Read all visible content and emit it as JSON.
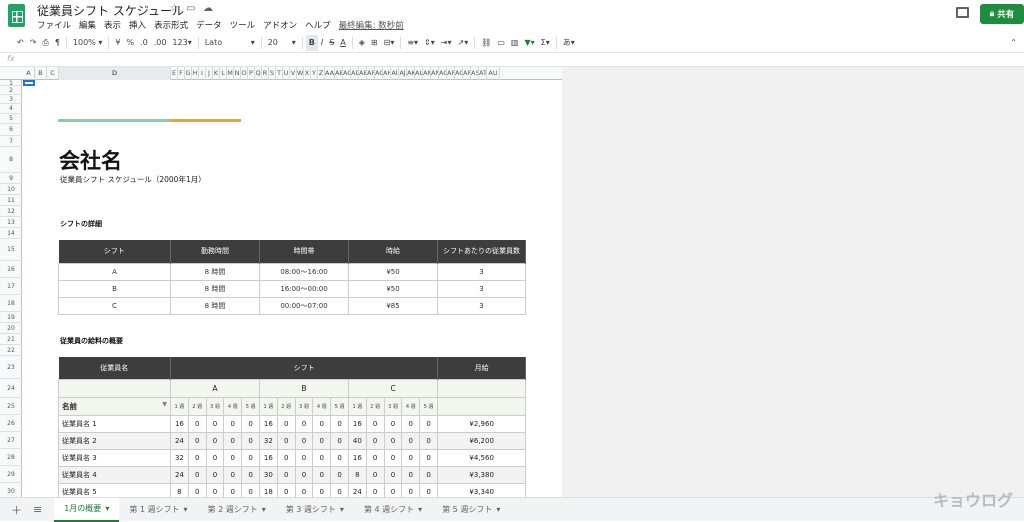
{
  "app": {
    "title": "従業員シフト スケジュール",
    "menu": [
      "ファイル",
      "編集",
      "表示",
      "挿入",
      "表示形式",
      "データ",
      "ツール",
      "アドオン",
      "ヘルプ"
    ],
    "last_edit": "最終編集: 数秒前",
    "share_label": "共有"
  },
  "toolbar": {
    "zoom": "100%",
    "currency": "¥",
    "percent": "%",
    "dec_less": ".0",
    "dec_more": ".00",
    "format": "123",
    "font": "Lato",
    "font_size": "20",
    "bold": "B",
    "italic": "I",
    "strike": "S",
    "text_color": "A",
    "lang": "あ"
  },
  "formula": {
    "fx": "fx"
  },
  "columns": [
    "A",
    "B",
    "C",
    "D",
    "E",
    "F",
    "G",
    "H",
    "I",
    "J",
    "K",
    "L",
    "M",
    "N",
    "O",
    "P",
    "Q",
    "R",
    "S",
    "T",
    "U",
    "V",
    "W",
    "X",
    "Y",
    "Z",
    "AA",
    "AB",
    "AC",
    "AD",
    "AE",
    "AF",
    "AG",
    "AH",
    "AI",
    "AJ",
    "AK",
    "AL",
    "AM",
    "AN",
    "AO",
    "AP",
    "AQ",
    "AR",
    "AS",
    "AT",
    "AU"
  ],
  "rows": [
    "1",
    "2",
    "3",
    "4",
    "5",
    "6",
    "7",
    "8",
    "9",
    "10",
    "11",
    "12",
    "13",
    "14",
    "15",
    "16",
    "17",
    "18",
    "19",
    "20",
    "21",
    "22",
    "23",
    "24",
    "25",
    "26",
    "27",
    "28",
    "29",
    "30"
  ],
  "content": {
    "company": "会社名",
    "subtitle": "従業員シフト スケジュール（2000年1月）",
    "shift_heading": "シフトの詳細",
    "salary_heading": "従業員の給料の概要"
  },
  "shift_table": {
    "headers": [
      "シフト",
      "勤務時間",
      "時間帯",
      "時給",
      "シフトあたりの従業員数"
    ],
    "rows": [
      [
        "A",
        "8 時間",
        "08:00～16:00",
        "¥50",
        "3"
      ],
      [
        "B",
        "8 時間",
        "16:00～00:00",
        "¥50",
        "3"
      ],
      [
        "C",
        "8 時間",
        "00:00～07:00",
        "¥85",
        "3"
      ]
    ]
  },
  "salary_table": {
    "name_header": "従業員名",
    "shift_header": "シフト",
    "pay_header": "月給",
    "shifts": [
      "A",
      "B",
      "C"
    ],
    "weeks": [
      "1 週",
      "2 週",
      "3 週",
      "4 週",
      "5 週"
    ],
    "name_label": "名前",
    "rows": [
      {
        "name": "従業員名 1",
        "a": [
          "16",
          "0",
          "0",
          "0",
          "0"
        ],
        "b": [
          "16",
          "0",
          "0",
          "0",
          "0"
        ],
        "c": [
          "16",
          "0",
          "0",
          "0",
          "0"
        ],
        "pay": "¥2,960"
      },
      {
        "name": "従業員名 2",
        "a": [
          "24",
          "0",
          "0",
          "0",
          "0"
        ],
        "b": [
          "32",
          "0",
          "0",
          "0",
          "0"
        ],
        "c": [
          "40",
          "0",
          "0",
          "0",
          "0"
        ],
        "pay": "¥6,200"
      },
      {
        "name": "従業員名 3",
        "a": [
          "32",
          "0",
          "0",
          "0",
          "0"
        ],
        "b": [
          "16",
          "0",
          "0",
          "0",
          "0"
        ],
        "c": [
          "16",
          "0",
          "0",
          "0",
          "0"
        ],
        "pay": "¥4,560"
      },
      {
        "name": "従業員名 4",
        "a": [
          "24",
          "0",
          "0",
          "0",
          "0"
        ],
        "b": [
          "30",
          "0",
          "0",
          "0",
          "0"
        ],
        "c": [
          "8",
          "0",
          "0",
          "0",
          "0"
        ],
        "pay": "¥3,380"
      },
      {
        "name": "従業員名 5",
        "a": [
          "8",
          "0",
          "0",
          "0",
          "0"
        ],
        "b": [
          "18",
          "0",
          "0",
          "0",
          "0"
        ],
        "c": [
          "24",
          "0",
          "0",
          "0",
          "0"
        ],
        "pay": "¥3,340"
      }
    ]
  },
  "tabs": [
    {
      "label": "1月の概要",
      "active": true
    },
    {
      "label": "第 1 週シフト"
    },
    {
      "label": "第 2 週シフト"
    },
    {
      "label": "第 3 週シフト"
    },
    {
      "label": "第 4 週シフト"
    },
    {
      "label": "第 5 週シフト"
    }
  ],
  "watermark": "キョウログ"
}
